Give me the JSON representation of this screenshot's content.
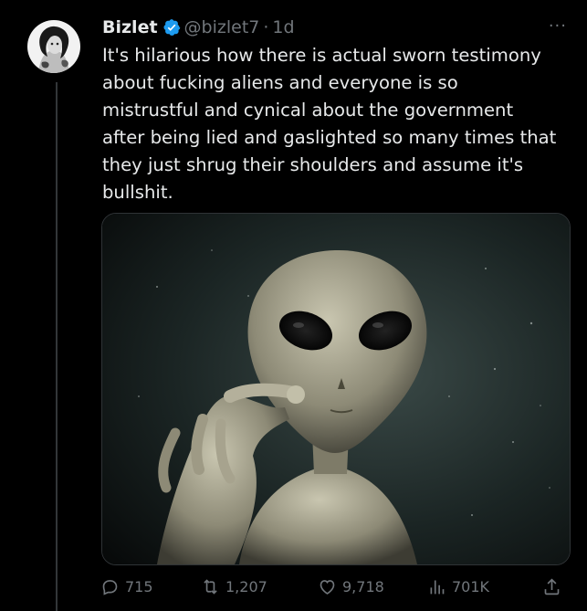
{
  "tweet": {
    "author_name": "Bizlet",
    "handle": "@bizlet7",
    "separator": "·",
    "time": "1d",
    "more_label": "···",
    "text": "It's hilarious how there is actual sworn testimony\nabout fucking aliens and everyone is so\nmistrustful and cynical about the government\nafter being lied and gaslighted so many times that\nthey just shrug their shoulders and assume it's\nbullshit.",
    "verified_color": "#1d9bf0"
  },
  "actions": {
    "reply_count": "715",
    "retweet_count": "1,207",
    "like_count": "9,718",
    "views_count": "701K"
  },
  "icons": [
    "verified-badge-icon",
    "reply-icon",
    "retweet-icon",
    "like-icon",
    "views-icon",
    "share-icon"
  ]
}
